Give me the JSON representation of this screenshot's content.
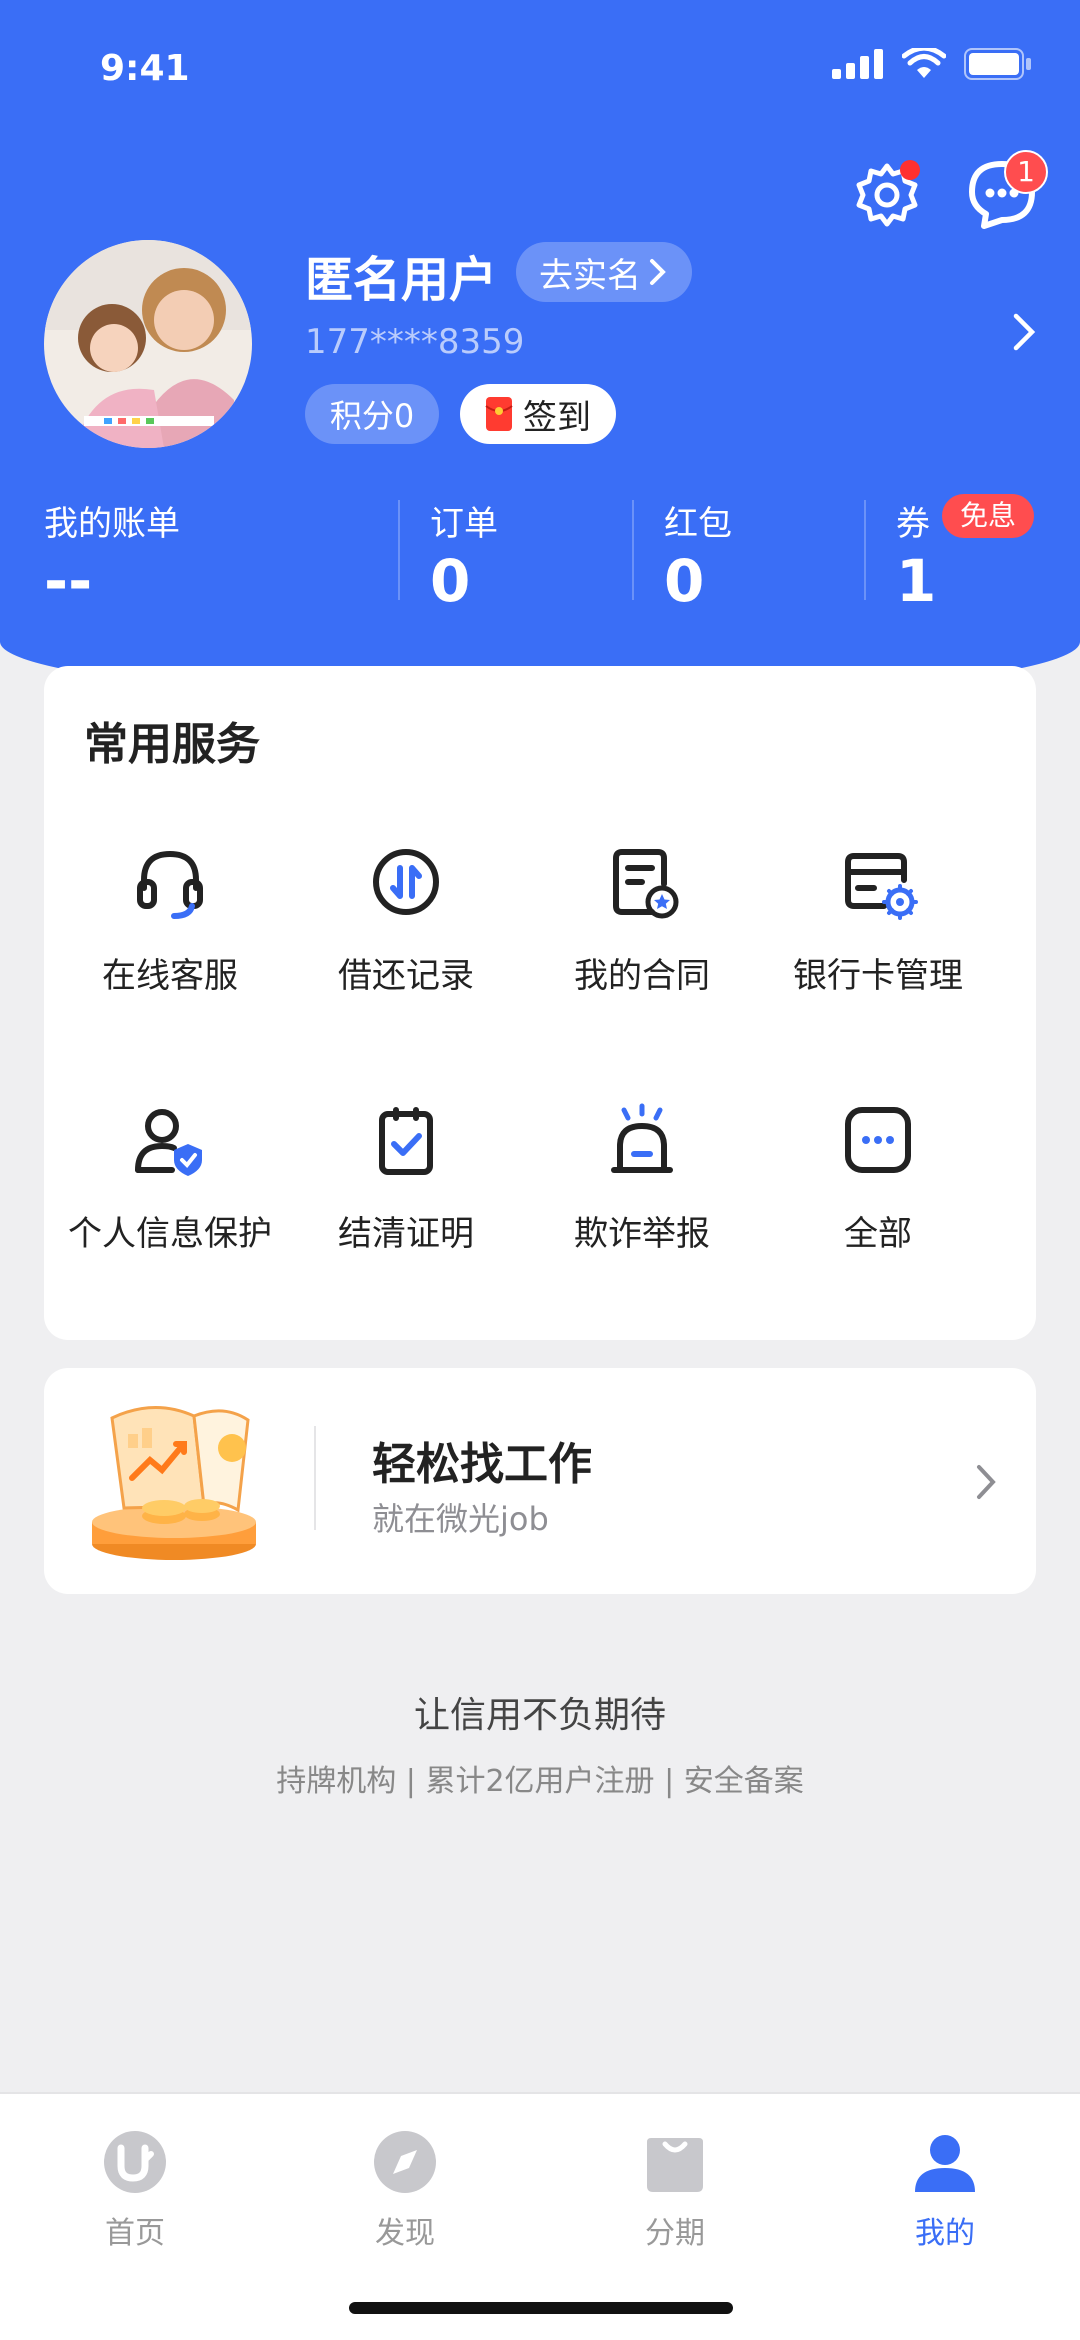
{
  "status_bar": {
    "time": "9:41"
  },
  "profile": {
    "username": "匿名用户",
    "verify_label": "去实名",
    "phone": "177****8359",
    "points_label": "积分0",
    "checkin_label": "签到"
  },
  "stats": [
    {
      "label": "我的账单",
      "value": "--"
    },
    {
      "label": "订单",
      "value": "0"
    },
    {
      "label": "红包",
      "value": "0"
    },
    {
      "label": "券",
      "value": "1",
      "badge": "免息"
    }
  ],
  "messages_badge": "1",
  "services": {
    "title": "常用服务",
    "items": [
      {
        "label": "在线客服",
        "icon": "headset-icon"
      },
      {
        "label": "借还记录",
        "icon": "transfer-icon"
      },
      {
        "label": "我的合同",
        "icon": "contract-icon"
      },
      {
        "label": "银行卡管理",
        "icon": "bank-card-icon"
      },
      {
        "label": "个人信息保护",
        "icon": "privacy-shield-icon"
      },
      {
        "label": "结清证明",
        "icon": "clipboard-check-icon"
      },
      {
        "label": "欺诈举报",
        "icon": "alarm-icon"
      },
      {
        "label": "全部",
        "icon": "more-icon"
      }
    ]
  },
  "promo": {
    "title": "轻松找工作",
    "subtitle": "就在微光job"
  },
  "footer": {
    "slogan": "让信用不负期待",
    "tagline": "持牌机构 | 累计2亿用户注册 | 安全备案"
  },
  "tabbar": [
    {
      "label": "首页",
      "active": false
    },
    {
      "label": "发现",
      "active": false
    },
    {
      "label": "分期",
      "active": false
    },
    {
      "label": "我的",
      "active": true
    }
  ],
  "colors": {
    "brand_blue": "#3a6ef6",
    "badge_red": "#ff4d4f"
  }
}
